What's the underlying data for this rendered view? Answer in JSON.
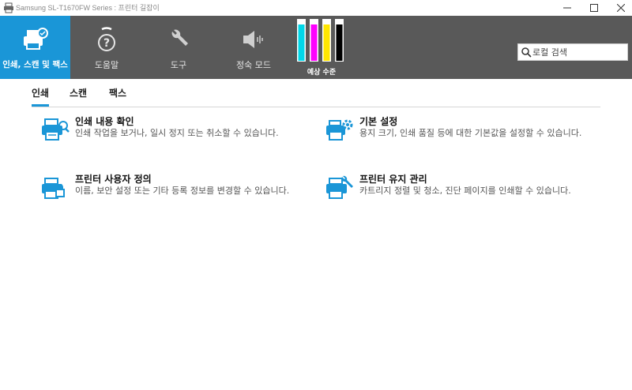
{
  "window": {
    "title": "Samsung SL-T1670FW Series : 프린터 길잡이",
    "app_icon": "printer-icon"
  },
  "toolbar": {
    "items": [
      {
        "label": "인쇄, 스캔 및 팩스",
        "icon": "printer-scan-icon",
        "active": true
      },
      {
        "label": "도움말",
        "icon": "help-icon",
        "active": false
      },
      {
        "label": "도구",
        "icon": "wrench-icon",
        "active": false
      },
      {
        "label": "정숙 모드",
        "icon": "speaker-quiet-icon",
        "active": false
      }
    ],
    "ink": {
      "label": "예상 수준",
      "cartridges": [
        {
          "color": "#00d7e8",
          "level": 0.85
        },
        {
          "color": "#ff00ff",
          "level": 0.85
        },
        {
          "color": "#ffe600",
          "level": 0.85
        },
        {
          "color": "#000000",
          "level": 0.85
        }
      ]
    },
    "search": {
      "placeholder": "로컬 검색",
      "value": ""
    }
  },
  "tabs": [
    {
      "label": "인쇄",
      "active": true
    },
    {
      "label": "스캔",
      "active": false
    },
    {
      "label": "팩스",
      "active": false
    }
  ],
  "items": [
    {
      "title": "인쇄 내용 확인",
      "description": "인쇄 작업을 보거나, 일시 정지 또는 취소할 수 있습니다.",
      "icon": "print-queue-icon"
    },
    {
      "title": "기본 설정",
      "description": "용지 크기, 인쇄 품질 등에 대한 기본값을 설정할 수 있습니다.",
      "icon": "printer-settings-icon"
    },
    {
      "title": "프린터 사용자 정의",
      "description": "이름, 보안 설정 또는 기타 등록 정보를 변경할 수 있습니다.",
      "icon": "printer-lock-icon"
    },
    {
      "title": "프린터 유지 관리",
      "description": "카트리지 정렬 및 청소, 진단 페이지를 인쇄할 수 있습니다.",
      "icon": "printer-maintenance-icon"
    }
  ],
  "colors": {
    "accent": "#1a96d7",
    "toolbar_bg": "#595959"
  }
}
